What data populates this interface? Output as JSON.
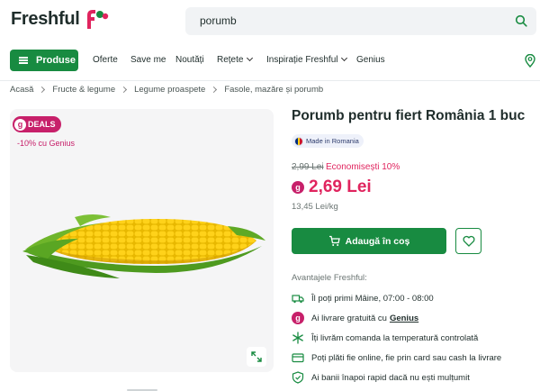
{
  "header": {
    "logo_text": "Freshful",
    "search_value": "porumb"
  },
  "nav": {
    "produse": "Produse",
    "items": [
      "Oferte",
      "Save me",
      "Noutăți",
      "Rețete",
      "Inspirație Freshful",
      "Genius"
    ]
  },
  "breadcrumb": [
    "Acasă",
    "Fructe & legume",
    "Legume proaspete",
    "Fasole, mazăre și porumb"
  ],
  "product": {
    "deals_g": "g",
    "deals_label": "DEALS",
    "genius_discount": "-10% cu Genius",
    "title": "Porumb pentru fiert România 1 buc",
    "origin": "Made in Romania",
    "old_price": "2,99 Lei",
    "savings": "Economisești 10%",
    "genius_g": "g",
    "price": "2,69 Lei",
    "unit_price": "13,45 Lei/kg",
    "add_to_cart": "Adaugă în coș"
  },
  "advantages": {
    "title": "Avantajele Freshful:",
    "items": [
      {
        "icon": "truck-icon",
        "text": "Îl poți primi Mâine, 07:00 - 08:00"
      },
      {
        "icon": "genius-icon",
        "text": "Ai livrare gratuită cu",
        "link": "Genius"
      },
      {
        "icon": "snowflake-icon",
        "text": "Îți livrăm comanda la temperatură controlată"
      },
      {
        "icon": "card-icon",
        "text": "Poți plăti fie online, fie prin card sau cash la livrare"
      },
      {
        "icon": "shield-icon",
        "text": "Ai banii înapoi rapid dacă nu ești mulțumit"
      }
    ]
  },
  "colors": {
    "brand_green": "#188b41",
    "price_red": "#e0245e",
    "genius_magenta": "#c7206a"
  }
}
